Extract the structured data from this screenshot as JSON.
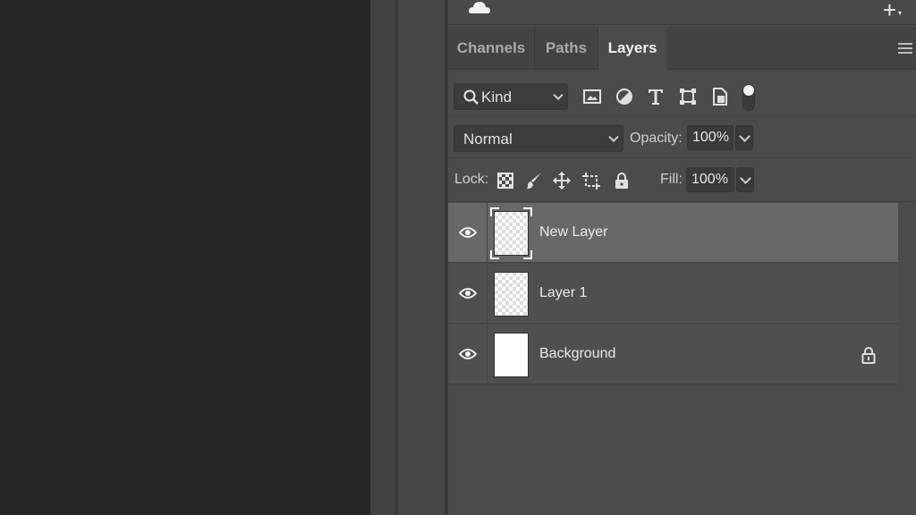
{
  "tabs": [
    {
      "label": "Channels",
      "active": false
    },
    {
      "label": "Paths",
      "active": false
    },
    {
      "label": "Layers",
      "active": true
    }
  ],
  "filter": {
    "kind_label": "Kind",
    "icons": [
      "image-filter-icon",
      "adjustment-filter-icon",
      "type-filter-icon",
      "shape-filter-icon",
      "smart-object-filter-icon"
    ]
  },
  "blend": {
    "mode": "Normal",
    "opacity_label": "Opacity:",
    "opacity_value": "100%"
  },
  "lock": {
    "label": "Lock:",
    "icons": [
      "lock-transparent-pixels-icon",
      "lock-image-pixels-icon",
      "lock-position-icon",
      "lock-artboard-icon",
      "lock-all-icon"
    ],
    "fill_label": "Fill:",
    "fill_value": "100%"
  },
  "layers": [
    {
      "name": "New Layer",
      "selected": true,
      "thumb": "transparent",
      "locked": false
    },
    {
      "name": "Layer 1",
      "selected": false,
      "thumb": "transparent",
      "locked": false
    },
    {
      "name": "Background",
      "selected": false,
      "thumb": "white",
      "locked": true
    }
  ],
  "colors": {
    "panel_bg": "#4b4b4b",
    "selected_layer": "#686868",
    "canvas_bg": "#262626"
  }
}
